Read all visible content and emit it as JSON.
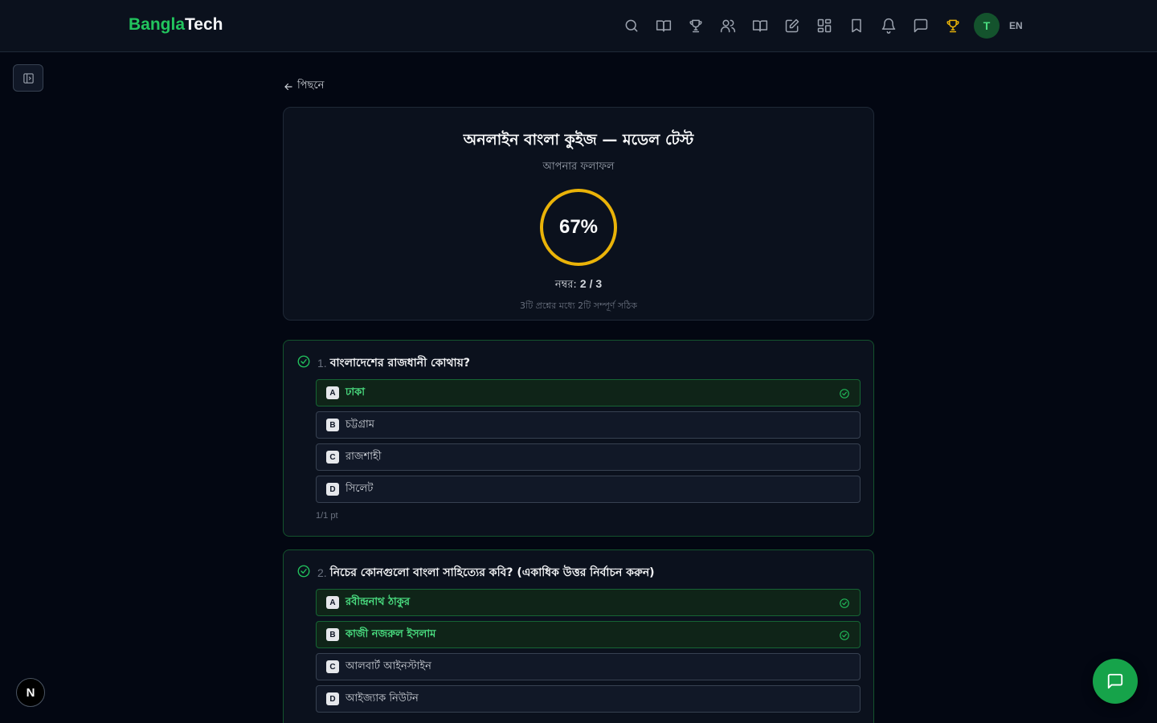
{
  "brand": {
    "part1": "Bangla",
    "part2": "Tech",
    "accent": "#22c55e"
  },
  "header": {
    "nav_icons": [
      "search-icon",
      "book-open-icon",
      "trophy-icon",
      "users-icon",
      "book-open-icon",
      "pencil-square-icon",
      "grid-icon",
      "bookmark-icon",
      "bell-icon",
      "message-icon",
      "trophy-icon"
    ],
    "avatar_initial": "T",
    "language": "EN"
  },
  "back_label": "পিছনে",
  "result": {
    "title": "অনলাইন বাংলা কুইজ — মডেল টেস্ট",
    "subtitle": "আপনার ফলাফল",
    "percent_text": "67%",
    "percent": 67,
    "score_label": "নম্বর:",
    "score_value": "2 / 3",
    "detail": "3টি প্রশ্নের মধ্যে 2টি সম্পূর্ণ সঠিক",
    "ring_color": "#eab308"
  },
  "questions": [
    {
      "number": "1.",
      "text": "বাংলাদেশের রাজধানী কোথায়?",
      "options": [
        {
          "letter": "A",
          "label": "ঢাকা",
          "correct": true
        },
        {
          "letter": "B",
          "label": "চট্টগ্রাম",
          "correct": false
        },
        {
          "letter": "C",
          "label": "রাজশাহী",
          "correct": false
        },
        {
          "letter": "D",
          "label": "সিলেট",
          "correct": false
        }
      ],
      "points": "1/1 pt"
    },
    {
      "number": "2.",
      "text": "নিচের কোনগুলো বাংলা সাহিত্যের কবি? (একাধিক উত্তর নির্বাচন করুন)",
      "options": [
        {
          "letter": "A",
          "label": "রবীন্দ্রনাথ ঠাকুর",
          "correct": true
        },
        {
          "letter": "B",
          "label": "কাজী নজরুল ইসলাম",
          "correct": true
        },
        {
          "letter": "C",
          "label": "আলবার্ট আইনস্টাইন",
          "correct": false
        },
        {
          "letter": "D",
          "label": "আইজ্যাক নিউটন",
          "correct": false
        }
      ]
    }
  ],
  "next_badge": "N"
}
